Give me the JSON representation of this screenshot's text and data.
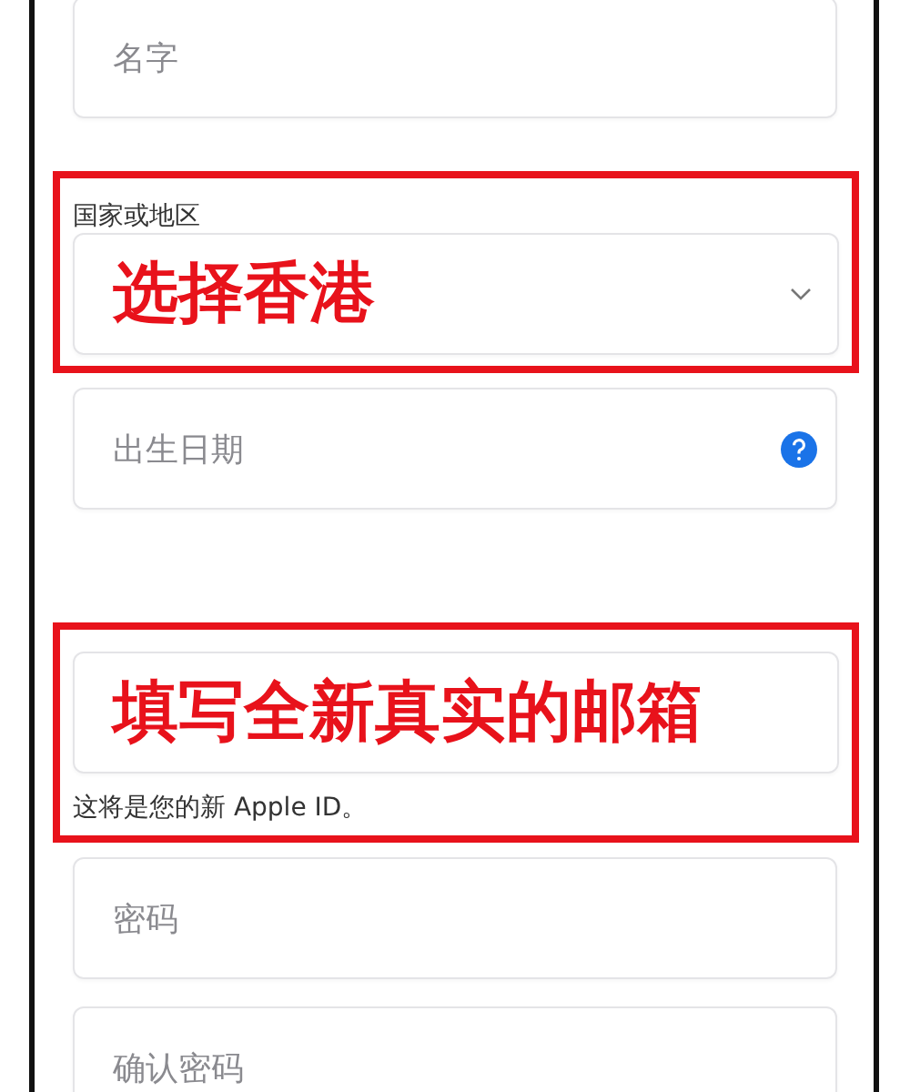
{
  "fields": [
    {
      "kind": "text",
      "placeholder": "名字",
      "highlighted": false
    },
    {
      "kind": "select",
      "label": "国家或地区",
      "annotation": "选择香港",
      "highlighted": true
    },
    {
      "kind": "date",
      "placeholder": "出生日期",
      "highlighted": false
    },
    {
      "kind": "email",
      "annotation": "填写全新真实的邮箱",
      "hint": "这将是您的新 Apple ID。",
      "highlighted": true
    },
    {
      "kind": "password",
      "placeholder": "密码",
      "highlighted": false
    },
    {
      "kind": "password",
      "placeholder": "确认密码",
      "highlighted": false
    }
  ]
}
